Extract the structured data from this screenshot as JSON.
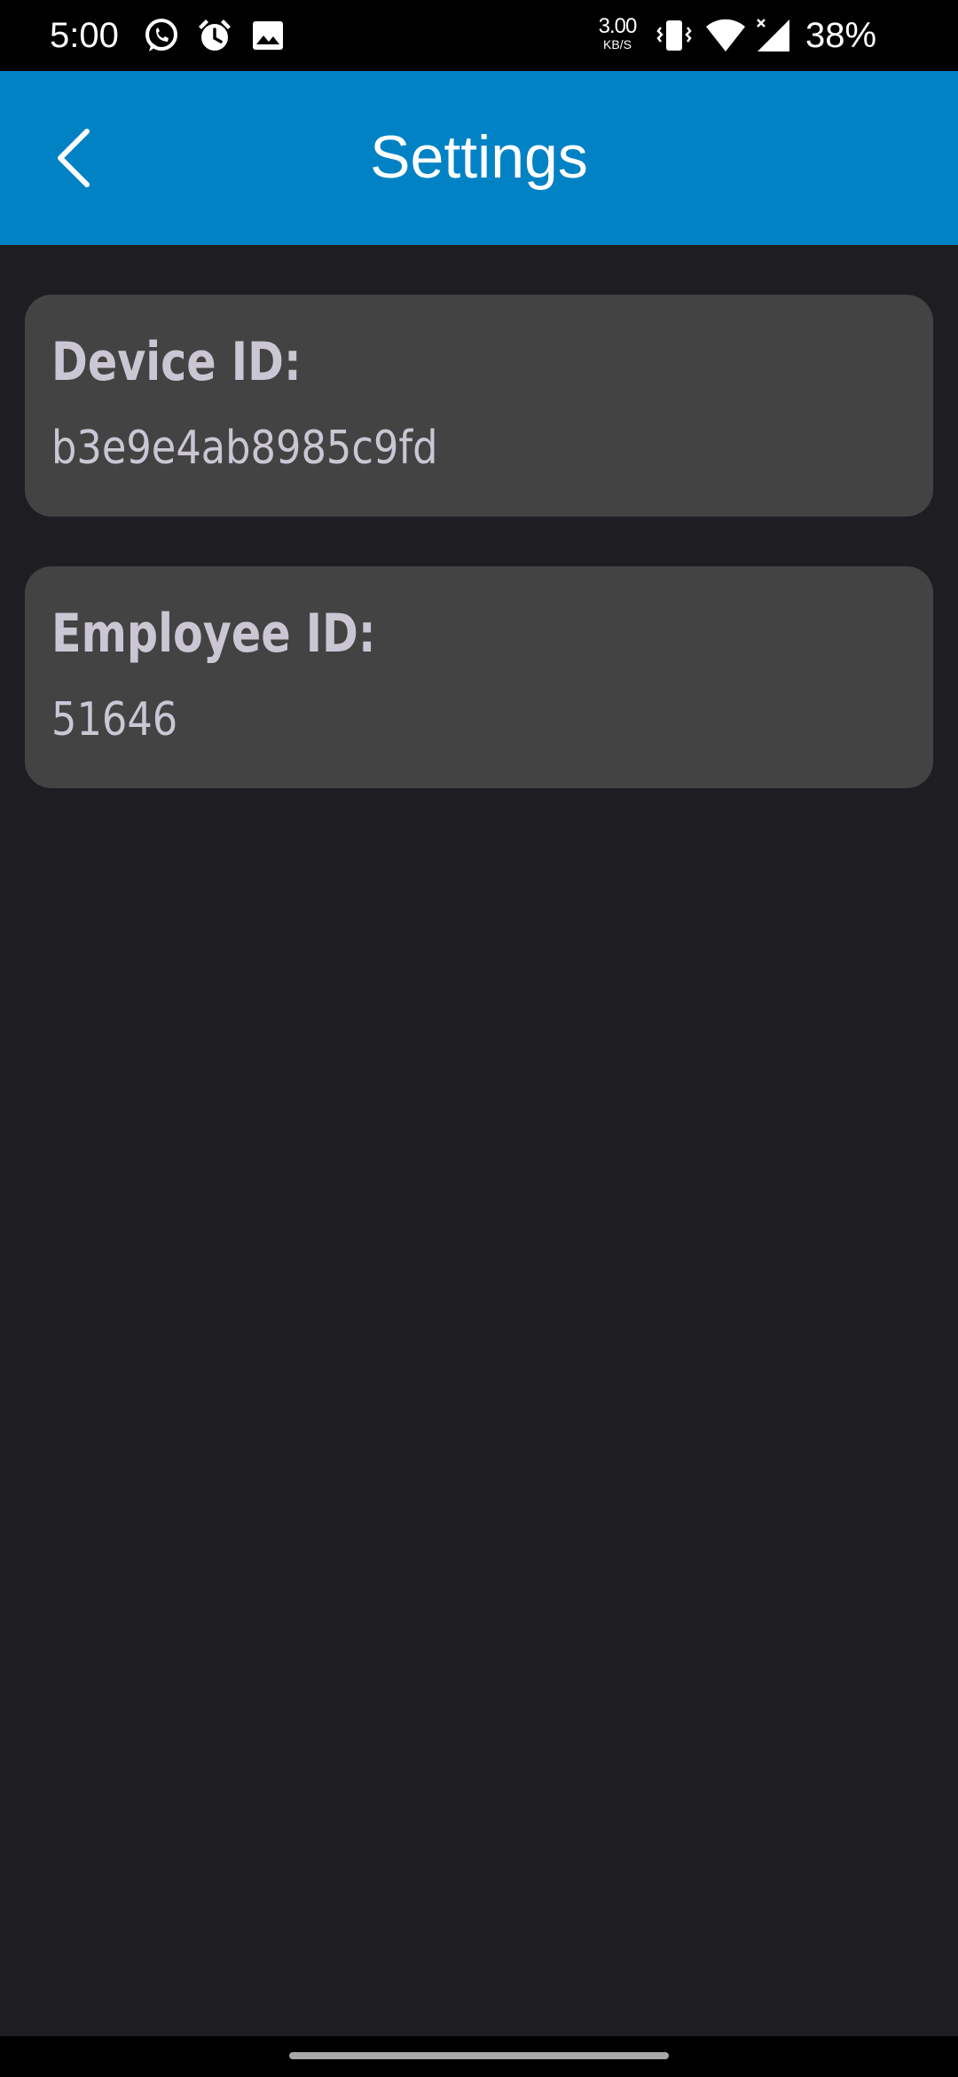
{
  "status_bar": {
    "time": "5:00",
    "net_speed_value": "3.00",
    "net_speed_unit": "KB/S",
    "battery": "38%",
    "icons": [
      "whatsapp-icon",
      "alarm-icon",
      "image-icon",
      "vibrate-icon",
      "wifi-icon",
      "cell-signal-icon"
    ]
  },
  "app_bar": {
    "title": "Settings",
    "back_icon": "chevron-left-icon",
    "background_color": "#0082c4"
  },
  "cards": {
    "device": {
      "label": "Device ID:",
      "value": "b3e9e4ab8985c9fd"
    },
    "employee": {
      "label": "Employee ID:",
      "value": "51646"
    }
  },
  "colors": {
    "background": "#1e1d22",
    "card": "#434343",
    "card_text": "#cbc6d3"
  }
}
